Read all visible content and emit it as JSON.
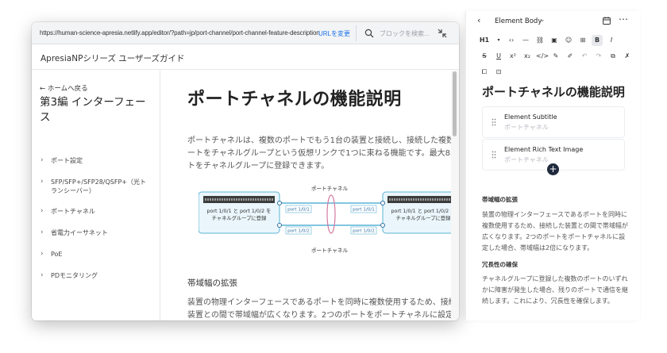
{
  "browser": {
    "url": "https://human-science-apresia.netlify.app/editor/?path=jp/port-channel/port-channel-feature-description",
    "url_change": "URLを変更",
    "search_placeholder": "ブロックを検索..."
  },
  "site": {
    "title": "ApresiaNPシリーズ ユーザーズガイド"
  },
  "sidebar": {
    "back": "← ホームへ戻る",
    "chapter": "第3編 インターフェース",
    "items": [
      {
        "label": "ポート設定"
      },
      {
        "label": "SFP/SFP+/SFP28/QSFP+（光トランシーバー）"
      },
      {
        "label": "ポートチャネル"
      },
      {
        "label": "省電力イーサネット"
      },
      {
        "label": "PoE"
      },
      {
        "label": "PDモニタリング"
      }
    ]
  },
  "article": {
    "title": "ポートチャネルの機能説明",
    "intro": "ポートチャネルは、複数のポートでもう1台の装置と接続し、接続した複数のポートをチャネルグループという仮想リンクで1つに束ねる機能です。最大8ポートをチャネルグループに登録できます。",
    "diagram": {
      "top_label": "ポートチャネル",
      "bottom_label": "ポートチャネル",
      "left_box": "port 1/0/1 と port 1/0/2 を\nチャネルグループに登録",
      "right_box": "port 1/0/1 と port 1/0/2 を\nチャネルグループに登録",
      "port_a": "port 1/0/1",
      "port_b": "port 1/0/2",
      "accent": "#5ab4d6"
    },
    "h2": "帯域幅の拡張",
    "para2": "装置の物理インターフェースであるポートを同時に複数使用するため、接続した装置との間で帯域幅が広くなります。2つのポートをポートチャネルに設定した場合、帯域幅は2倍になります。"
  },
  "editor": {
    "header_title": "Element Body",
    "toolbar": {
      "row1": [
        "H1",
        "B",
        "I",
        "<>",
        "—",
        "🔗",
        "▣",
        "☺",
        "⊞",
        "B",
        "I"
      ],
      "row2": [
        "S",
        "U",
        "x²",
        "x₂",
        "</>",
        "✎",
        "↶",
        "↷",
        "⧉",
        "✕",
        "⊡"
      ]
    },
    "h1": "ポートチャネルの機能説明",
    "fields": [
      {
        "label": "Element Subtitle",
        "value": "ポートチャネル"
      },
      {
        "label": "Element Rich Text Image",
        "value": "ポートチャネル"
      }
    ],
    "section1_h": "帯域幅の拡張",
    "section1_p": "装置の物理インターフェースであるポートを同時に複数使用するため、接続した装置との間で帯域幅が広くなります。2つのポートをポートチャネルに設定した場合、帯域幅は2倍になります。",
    "section2_h": "冗長性の確保",
    "section2_p": "チャネルグループに登録した複数のポートのいずれかに障害が発生した場合、残りのポートで通信を継続します。これにより、冗長性を確保します。"
  }
}
